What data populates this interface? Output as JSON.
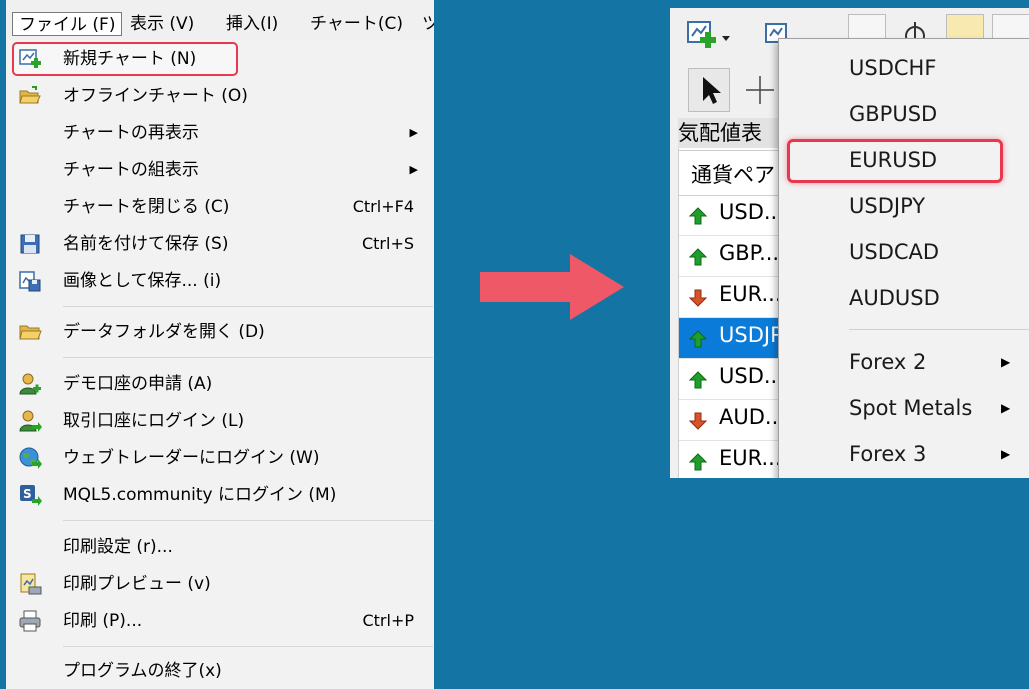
{
  "menubar": {
    "items": [
      "ファイル (F)",
      "表示 (V)",
      "挿入(I)",
      "チャート(C)",
      "ツ"
    ]
  },
  "file_menu": {
    "items": [
      {
        "label": "新規チャート (N)",
        "shortcut": "",
        "icon": "new-chart-icon",
        "submenu": false,
        "highlighted": true
      },
      {
        "label": "オフラインチャート (O)",
        "shortcut": "",
        "icon": "open-folder-icon",
        "submenu": false
      },
      {
        "label": "チャートの再表示",
        "shortcut": "",
        "icon": "",
        "submenu": true
      },
      {
        "label": "チャートの組表示",
        "shortcut": "",
        "icon": "",
        "submenu": true
      },
      {
        "label": "チャートを閉じる (C)",
        "shortcut": "Ctrl+F4",
        "icon": "",
        "submenu": false
      },
      {
        "label": "名前を付けて保存 (S)",
        "shortcut": "Ctrl+S",
        "icon": "save-icon",
        "submenu": false
      },
      {
        "label": "画像として保存... (i)",
        "shortcut": "",
        "icon": "save-image-icon",
        "submenu": false
      },
      {
        "label": "データフォルダを開く (D)",
        "shortcut": "",
        "icon": "folder-icon",
        "submenu": false
      },
      {
        "label": "デモ口座の申請 (A)",
        "shortcut": "",
        "icon": "demo-account-icon",
        "submenu": false
      },
      {
        "label": "取引口座にログイン (L)",
        "shortcut": "",
        "icon": "login-account-icon",
        "submenu": false
      },
      {
        "label": "ウェブトレーダーにログイン (W)",
        "shortcut": "",
        "icon": "web-trader-icon",
        "submenu": false
      },
      {
        "label": "MQL5.community にログイン (M)",
        "shortcut": "",
        "icon": "mql5-icon",
        "submenu": false
      },
      {
        "label": "印刷設定 (r)...",
        "shortcut": "",
        "icon": "",
        "submenu": false
      },
      {
        "label": "印刷プレビュー (v)",
        "shortcut": "",
        "icon": "print-preview-icon",
        "submenu": false
      },
      {
        "label": "印刷 (P)...",
        "shortcut": "Ctrl+P",
        "icon": "printer-icon",
        "submenu": false
      },
      {
        "label": "プログラムの終了(x)",
        "shortcut": "",
        "icon": "",
        "submenu": false
      }
    ]
  },
  "market_watch": {
    "title": "気配値表",
    "header": "通貨ペア",
    "rows": [
      {
        "symbol": "USD...",
        "direction": "up"
      },
      {
        "symbol": "GBP...",
        "direction": "up"
      },
      {
        "symbol": "EUR...",
        "direction": "down"
      },
      {
        "symbol": "USDJP",
        "direction": "up",
        "selected": true
      },
      {
        "symbol": "USD...",
        "direction": "up"
      },
      {
        "symbol": "AUD...",
        "direction": "down"
      },
      {
        "symbol": "EUR...",
        "direction": "up"
      }
    ]
  },
  "symbol_menu": {
    "items": [
      {
        "label": "USDCHF",
        "submenu": false
      },
      {
        "label": "GBPUSD",
        "submenu": false
      },
      {
        "label": "EURUSD",
        "submenu": false,
        "highlighted": true
      },
      {
        "label": "USDJPY",
        "submenu": false
      },
      {
        "label": "USDCAD",
        "submenu": false
      },
      {
        "label": "AUDUSD",
        "submenu": false
      },
      {
        "label": "Forex 2",
        "submenu": true
      },
      {
        "label": "Spot Metals",
        "submenu": true
      },
      {
        "label": "Forex 3",
        "submenu": true
      }
    ]
  },
  "colors": {
    "background": "#1474a3",
    "highlight": "#e8384f",
    "arrow": "#ef5866",
    "selection": "#0a7bd9",
    "up": "#1e9e2a",
    "down": "#d9522a"
  }
}
